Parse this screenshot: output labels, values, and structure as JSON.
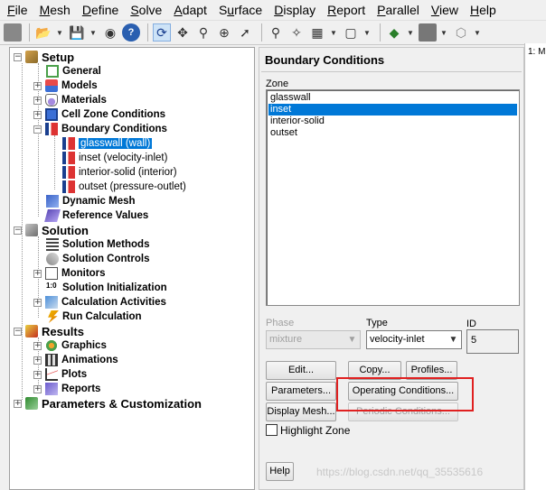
{
  "menubar": {
    "items": [
      {
        "label": "File",
        "mnemonic": "F"
      },
      {
        "label": "Mesh",
        "mnemonic": "M"
      },
      {
        "label": "Define",
        "mnemonic": "D"
      },
      {
        "label": "Solve",
        "mnemonic": "S"
      },
      {
        "label": "Adapt",
        "mnemonic": "A"
      },
      {
        "label": "Surface",
        "mnemonic": "u"
      },
      {
        "label": "Display",
        "mnemonic": "D"
      },
      {
        "label": "Report",
        "mnemonic": "R"
      },
      {
        "label": "Parallel",
        "mnemonic": "P"
      },
      {
        "label": "View",
        "mnemonic": "V"
      },
      {
        "label": "Help",
        "mnemonic": "H"
      }
    ]
  },
  "tree": {
    "setup": "Setup",
    "general": "General",
    "models": "Models",
    "materials": "Materials",
    "cell_zone": "Cell Zone Conditions",
    "boundary": "Boundary Conditions",
    "bc_items": [
      "glasswall (wall)",
      "inset (velocity-inlet)",
      "interior-solid (interior)",
      "outset (pressure-outlet)"
    ],
    "dynamic_mesh": "Dynamic Mesh",
    "reference_values": "Reference Values",
    "solution": "Solution",
    "solution_methods": "Solution Methods",
    "solution_controls": "Solution Controls",
    "monitors": "Monitors",
    "solution_init": "Solution Initialization",
    "calc_activities": "Calculation Activities",
    "run_calc": "Run Calculation",
    "results": "Results",
    "graphics": "Graphics",
    "animations": "Animations",
    "plots": "Plots",
    "reports": "Reports",
    "params": "Parameters & Customization",
    "init_icon_text": "1:0"
  },
  "panel": {
    "title": "Boundary Conditions",
    "zone_label": "Zone",
    "zones": [
      "glasswall",
      "inset",
      "interior-solid",
      "outset"
    ],
    "selected_zone": "inset",
    "phase_label": "Phase",
    "phase_value": "mixture",
    "type_label": "Type",
    "type_value": "velocity-inlet",
    "id_label": "ID",
    "id_value": "5",
    "buttons": {
      "edit": "Edit...",
      "copy": "Copy...",
      "profiles": "Profiles...",
      "parameters": "Parameters...",
      "operating": "Operating Conditions...",
      "display_mesh": "Display Mesh...",
      "periodic": "Periodic Conditions...",
      "help": "Help"
    },
    "highlight_zone": "Highlight Zone"
  },
  "graphics_tab": "1: M",
  "watermark": "https://blog.csdn.net/qq_35535616",
  "colors": {
    "selection": "#0078d7",
    "highlight_box": "#e02020"
  }
}
